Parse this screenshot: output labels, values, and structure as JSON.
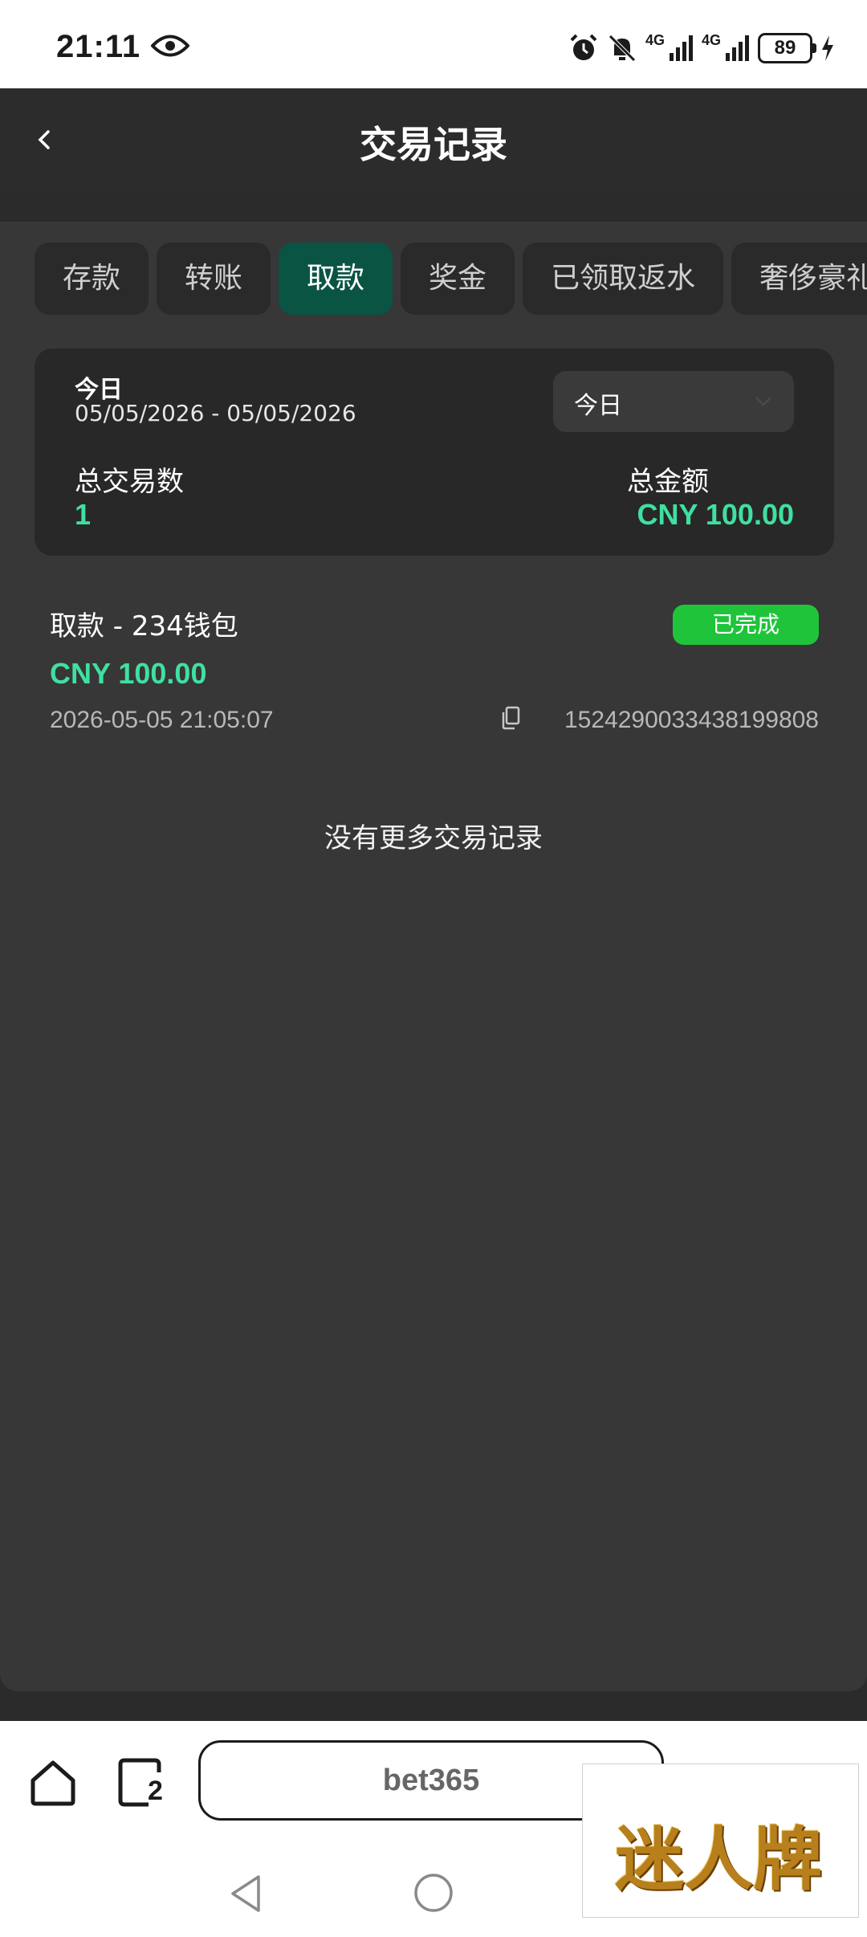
{
  "status_bar": {
    "time": "21:11",
    "net1": "4G",
    "net2": "4G",
    "battery": "89"
  },
  "header": {
    "title": "交易记录"
  },
  "tabs": [
    {
      "label": "存款",
      "active": false
    },
    {
      "label": "转账",
      "active": false
    },
    {
      "label": "取款",
      "active": true
    },
    {
      "label": "奖金",
      "active": false
    },
    {
      "label": "已领取返水",
      "active": false
    },
    {
      "label": "奢侈豪礼",
      "active": false
    }
  ],
  "summary": {
    "period": "今日",
    "range": "05/05/2026 - 05/05/2026",
    "select_value": "今日",
    "count_label": "总交易数",
    "count_value": "1",
    "amount_label": "总金额",
    "amount_value": "CNY 100.00"
  },
  "transactions": [
    {
      "title": "取款 - 234钱包",
      "status": "已完成",
      "amount": "CNY 100.00",
      "time": "2026-05-05 21:05:07",
      "id": "1524290033438199808"
    }
  ],
  "no_more_text": "没有更多交易记录",
  "browser": {
    "tab_count": "2",
    "url": "bet365"
  },
  "watermark": "迷人牌",
  "colors": {
    "accent_green": "#3fe0a0",
    "active_tab": "#0a5444",
    "badge_green": "#1fc43b"
  }
}
